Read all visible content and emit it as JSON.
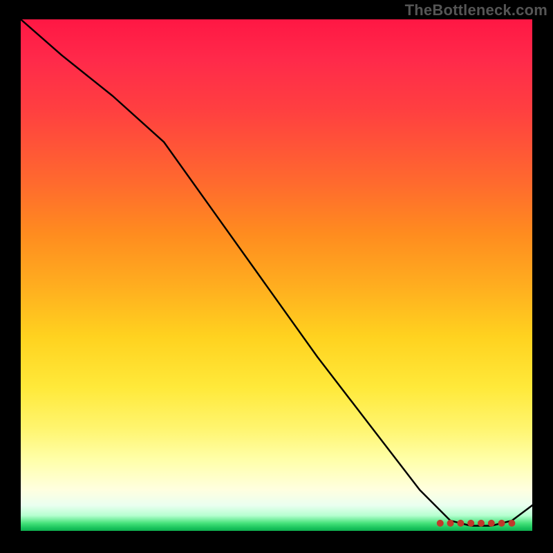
{
  "watermark": "TheBottleneck.com",
  "chart_data": {
    "type": "line",
    "title": "",
    "xlabel": "",
    "ylabel": "",
    "xlim": [
      0,
      100
    ],
    "ylim": [
      0,
      100
    ],
    "series": [
      {
        "name": "curve",
        "x": [
          0,
          8,
          18,
          28,
          38,
          48,
          58,
          68,
          78,
          84,
          88,
          92,
          96,
          100
        ],
        "values": [
          100,
          93,
          85,
          76,
          62,
          48,
          34,
          21,
          8,
          2,
          1,
          1,
          2,
          5
        ]
      }
    ],
    "bottom_markers": {
      "count": 8,
      "y": 1.5,
      "x_start": 82,
      "x_end": 96,
      "color": "#c0392b",
      "radius": 5
    },
    "colors": {
      "curve": "#000000",
      "background_top": "#ff1744",
      "background_bottom": "#0fae4e",
      "marker": "#c0392b"
    }
  }
}
